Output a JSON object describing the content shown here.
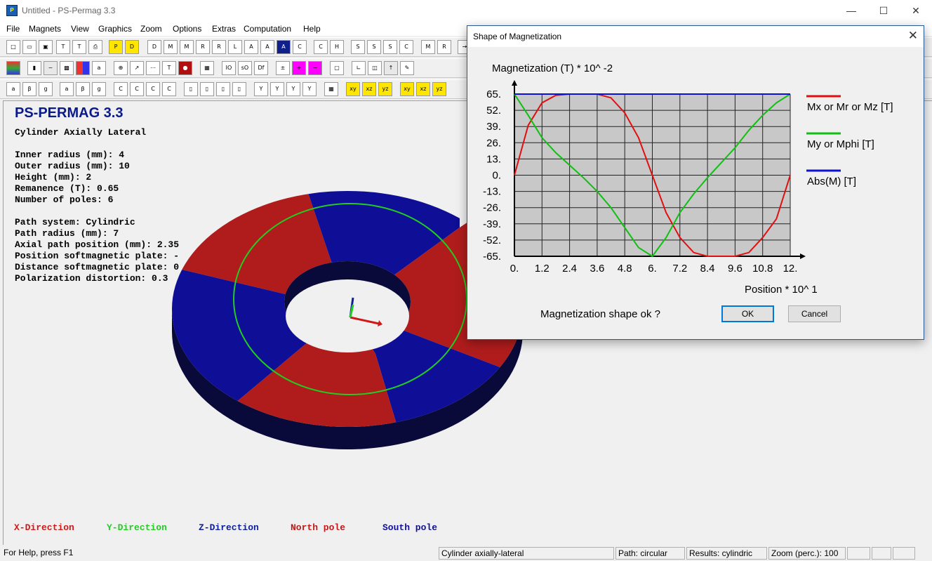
{
  "app": {
    "title": "Untitled - PS-Permag 3.3",
    "icon": "ps-permag-icon"
  },
  "menu": [
    "File",
    "Magnets",
    "View",
    "Graphics",
    "Zoom",
    "Options",
    "Extras",
    "Computation",
    "Help"
  ],
  "view": {
    "heading": "PS-PERMAG 3.3",
    "lines": [
      "Cylinder Axially Lateral",
      "",
      "Inner radius (mm): 4",
      "Outer radius (mm): 10",
      "Height (mm): 2",
      "Remanence (T): 0.65",
      "Number of poles: 6",
      "",
      "Path system: Cylindric",
      "Path radius (mm): 7",
      "Axial path position (mm): 2.35",
      "Position softmagnetic plate: -",
      "Distance softmagnetic plate: 0",
      "Polarization distortion: 0.3"
    ],
    "legend": [
      {
        "label": "X-Direction",
        "color": "#d01818"
      },
      {
        "label": "Y-Direction",
        "color": "#22cc22"
      },
      {
        "label": "Z-Direction",
        "color": "#10209a"
      },
      {
        "label": "North pole",
        "color": "#c01818"
      },
      {
        "label": "South pole",
        "color": "#10109a"
      }
    ],
    "colors": {
      "north": "#b01c1c",
      "south": "#0e0e96",
      "side": "#0a0a3a",
      "path": "#22cc22"
    }
  },
  "status": {
    "help": "For Help, press F1",
    "magnet": "Cylinder axially-lateral",
    "path": "Path: circular",
    "results": "Results: cylindric",
    "zoom": "Zoom (perc.): 100"
  },
  "dialog": {
    "title": "Shape of Magnetization",
    "ylabel": "Magnetization (T) * 10^ -2",
    "xlabel": "Position * 10^ 1",
    "question": "Magnetization shape ok ?",
    "ok_label": "OK",
    "cancel_label": "Cancel"
  },
  "chart_data": {
    "type": "line",
    "ylabel": "Magnetization (T) * 10^ -2",
    "xlabel": "Position * 10^ 1",
    "xlim": [
      0,
      12
    ],
    "ylim": [
      -65,
      65
    ],
    "grid": true,
    "legend_position": "right",
    "x_ticks": [
      "0.",
      "1.2",
      "2.4",
      "3.6",
      "4.8",
      "6.",
      "7.2",
      "8.4",
      "9.6",
      "10.8",
      "12."
    ],
    "y_ticks": [
      "65.",
      "52.",
      "39.",
      "26.",
      "13.",
      "0.",
      "-13.",
      "-26.",
      "-39.",
      "-52.",
      "-65."
    ],
    "x": [
      0,
      0.6,
      1.2,
      1.8,
      2.4,
      3.0,
      3.6,
      4.2,
      4.8,
      5.4,
      6.0,
      6.6,
      7.2,
      7.8,
      8.4,
      9.0,
      9.6,
      10.2,
      10.8,
      11.4,
      12.0
    ],
    "series": [
      {
        "name": "Mx or Mr or Mz [T]",
        "color": "#e01010",
        "values": [
          0,
          40,
          58,
          64,
          65,
          65,
          65,
          62,
          50,
          30,
          0,
          -30,
          -50,
          -62,
          -65,
          -65,
          -65,
          -62,
          -50,
          -35,
          0
        ]
      },
      {
        "name": "My or Mphi [T]",
        "color": "#10c010",
        "values": [
          65,
          48,
          30,
          18,
          8,
          -2,
          -13,
          -26,
          -42,
          -58,
          -65,
          -50,
          -30,
          -15,
          -2,
          10,
          22,
          36,
          48,
          58,
          65
        ]
      },
      {
        "name": "Abs(M) [T]",
        "color": "#1010d0",
        "values": [
          65,
          65,
          65,
          65,
          65,
          65,
          65,
          65,
          65,
          65,
          65,
          65,
          65,
          65,
          65,
          65,
          65,
          65,
          65,
          65,
          65
        ]
      }
    ]
  }
}
